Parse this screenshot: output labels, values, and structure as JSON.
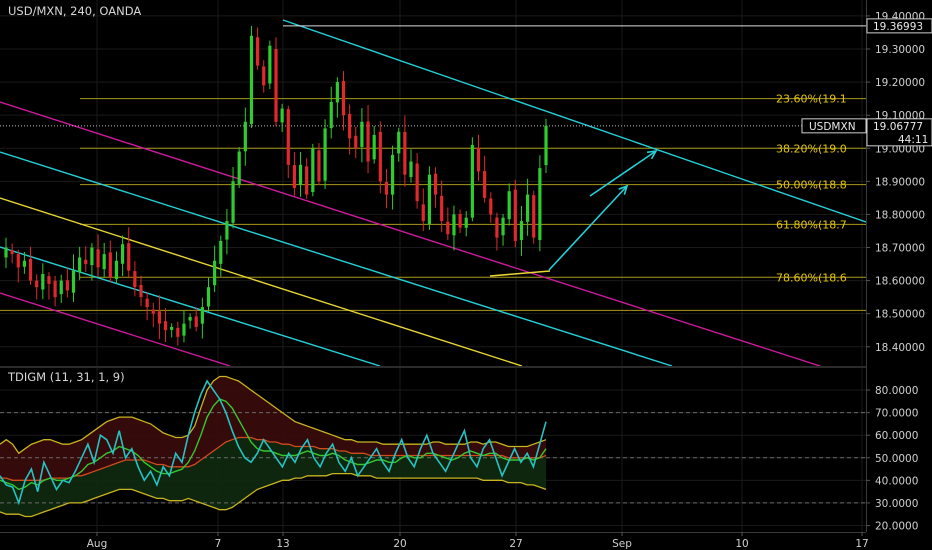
{
  "header": {
    "symbol_title": "USD/MXN, 240, OANDA",
    "indicator_title": "TDIGM (11, 31, 1, 9)"
  },
  "price_scale": {
    "ticks": [
      "19.40000",
      "19.30000",
      "19.20000",
      "19.10000",
      "19.00000",
      "18.90000",
      "18.80000",
      "18.70000",
      "18.60000",
      "18.50000",
      "18.40000"
    ],
    "high_label": "19.36993",
    "current_label": "19.06777",
    "symbol_tag": "USDMXN",
    "countdown": "44:11"
  },
  "indicator_scale": {
    "ticks": [
      "80.0000",
      "70.0000",
      "60.0000",
      "50.0000",
      "40.0000",
      "30.0000",
      "20.0000"
    ]
  },
  "time_axis": {
    "labels": [
      "Aug",
      "7",
      "13",
      "20",
      "27",
      "Sep",
      "10",
      "17"
    ]
  },
  "colors": {
    "background": "#000000",
    "bull": "#2ecc2e",
    "bear": "#e0282d",
    "channel_cyan": "#25d0d8",
    "channel_magenta": "#cc1a9c",
    "channel_yellow": "#e8d636",
    "fib": "#a89a18",
    "fib_text": "#e5c40c",
    "rsi_line": "#25c3c3",
    "band": "#c8b420",
    "ma_green": "#39c62f",
    "ma_red": "#d24a1e",
    "grid": "#1a1a1a"
  },
  "chart_data": [
    {
      "type": "candlestick",
      "title": "USD/MXN, 240, OANDA",
      "x_dates": [
        "Aug",
        "7",
        "13",
        "20",
        "27",
        "Sep",
        "10",
        "17"
      ],
      "ylim": [
        18.36,
        19.43
      ],
      "recent_high": 19.36993,
      "last_price": 19.06777,
      "close_path": [
        18.7,
        18.68,
        18.64,
        18.66,
        18.6,
        18.58,
        18.62,
        18.59,
        18.55,
        18.6,
        18.57,
        18.63,
        18.67,
        18.65,
        18.7,
        18.64,
        18.68,
        18.61,
        18.66,
        18.71,
        18.63,
        18.58,
        18.55,
        18.52,
        18.5,
        18.47,
        18.45,
        18.46,
        18.43,
        18.47,
        18.49,
        18.46,
        18.52,
        18.58,
        18.66,
        18.72,
        18.78,
        18.9,
        18.99,
        19.08,
        19.34,
        19.25,
        19.19,
        19.31,
        19.08,
        19.12,
        18.95,
        18.88,
        18.95,
        18.86,
        19.0,
        18.9,
        19.06,
        19.14,
        19.2,
        19.1,
        19.03,
        19.0,
        19.08,
        18.96,
        19.04,
        18.9,
        18.86,
        18.98,
        19.05,
        18.92,
        18.96,
        18.84,
        18.78,
        18.92,
        18.86,
        18.78,
        18.74,
        18.8,
        18.76,
        18.79,
        19.01,
        18.93,
        18.85,
        18.8,
        18.73,
        18.79,
        18.87,
        18.72,
        18.78,
        18.86,
        18.73,
        18.94,
        19.06777
      ],
      "fibonacci": [
        {
          "label": "23.60%(19.1",
          "value": 19.15
        },
        {
          "label": "38.20%(19.0",
          "value": 19.0
        },
        {
          "label": "50.00%(18.8",
          "value": 18.89
        },
        {
          "label": "61.80%(18.7",
          "value": 18.77
        },
        {
          "label": "78.60%(18.6",
          "value": 18.61
        },
        {
          "label": "",
          "value": 18.51
        }
      ]
    },
    {
      "type": "line",
      "title": "TDIGM (11, 31, 1, 9)",
      "ylim": [
        18,
        88
      ],
      "levels": [
        70,
        50,
        30
      ],
      "series": [
        {
          "values": [
            42,
            38,
            37,
            30,
            40,
            45,
            35,
            48,
            42,
            36,
            40,
            39,
            44,
            50,
            56,
            48,
            60,
            58,
            52,
            62,
            50,
            54,
            46,
            40,
            44,
            38,
            46,
            42,
            52,
            48,
            60,
            70,
            78,
            84,
            80,
            76,
            70,
            62,
            55,
            50,
            48,
            52,
            58,
            54,
            50,
            46,
            52,
            48,
            54,
            58,
            50,
            46,
            52,
            56,
            48,
            44,
            50,
            42,
            46,
            50,
            54,
            48,
            44,
            52,
            58,
            50,
            46,
            54,
            60,
            52,
            48,
            44,
            50,
            56,
            62,
            50,
            46,
            54,
            58,
            50,
            42,
            48,
            54,
            48,
            52,
            46,
            56,
            66
          ]
        },
        {
          "values": [
            40,
            39,
            38,
            36,
            37,
            39,
            38,
            40,
            41,
            40,
            40,
            41,
            42,
            44,
            47,
            48,
            50,
            52,
            53,
            55,
            54,
            53,
            51,
            48,
            46,
            44,
            43,
            43,
            44,
            45,
            48,
            53,
            60,
            68,
            73,
            76,
            75,
            72,
            67,
            62,
            57,
            54,
            53,
            53,
            52,
            51,
            51,
            51,
            52,
            53,
            52,
            51,
            51,
            52,
            51,
            49,
            48,
            47,
            47,
            48,
            49,
            49,
            48,
            48,
            50,
            51,
            50,
            50,
            52,
            52,
            51,
            50,
            49,
            50,
            52,
            53,
            52,
            51,
            52,
            52,
            50,
            49,
            49,
            49,
            50,
            49,
            50,
            54
          ]
        },
        {
          "values": [
            41,
            41,
            40,
            40,
            40,
            40,
            40,
            40,
            41,
            41,
            41,
            41,
            42,
            42,
            43,
            44,
            45,
            46,
            47,
            48,
            49,
            49,
            49,
            49,
            48,
            47,
            47,
            46,
            46,
            46,
            46,
            47,
            49,
            51,
            53,
            55,
            57,
            58,
            59,
            59,
            59,
            58,
            58,
            57,
            57,
            56,
            56,
            55,
            55,
            55,
            55,
            54,
            54,
            54,
            53,
            53,
            52,
            52,
            52,
            51,
            51,
            51,
            51,
            51,
            51,
            51,
            51,
            51,
            51,
            51,
            51,
            51,
            51,
            51,
            51,
            51,
            51,
            51,
            51,
            51,
            51,
            50,
            50,
            50,
            50,
            50,
            50,
            51
          ]
        },
        {
          "values": [
            56,
            58,
            56,
            52,
            54,
            56,
            57,
            58,
            58,
            57,
            56,
            56,
            57,
            58,
            60,
            62,
            64,
            66,
            67,
            68,
            68,
            68,
            67,
            66,
            65,
            63,
            61,
            60,
            59,
            59,
            60,
            64,
            72,
            80,
            84,
            86,
            86,
            85,
            84,
            82,
            80,
            78,
            76,
            74,
            72,
            70,
            68,
            66,
            65,
            64,
            63,
            62,
            61,
            60,
            59,
            58,
            58,
            57,
            57,
            57,
            57,
            56,
            56,
            56,
            56,
            56,
            56,
            56,
            56,
            57,
            57,
            56,
            56,
            56,
            56,
            57,
            57,
            56,
            57,
            57,
            56,
            55,
            55,
            55,
            55,
            56,
            57,
            58
          ]
        },
        {
          "values": [
            26,
            25,
            25,
            25,
            24,
            24,
            25,
            26,
            27,
            28,
            29,
            30,
            30,
            30,
            31,
            32,
            33,
            34,
            35,
            36,
            36,
            36,
            35,
            34,
            33,
            32,
            32,
            31,
            31,
            31,
            32,
            31,
            30,
            29,
            28,
            27,
            27,
            28,
            30,
            32,
            34,
            36,
            37,
            38,
            39,
            40,
            40,
            41,
            41,
            42,
            42,
            42,
            42,
            43,
            43,
            43,
            43,
            42,
            42,
            42,
            41,
            41,
            41,
            41,
            41,
            41,
            41,
            41,
            41,
            41,
            41,
            41,
            41,
            41,
            41,
            41,
            41,
            40,
            40,
            40,
            40,
            39,
            39,
            39,
            38,
            38,
            37,
            36
          ]
        }
      ]
    }
  ]
}
